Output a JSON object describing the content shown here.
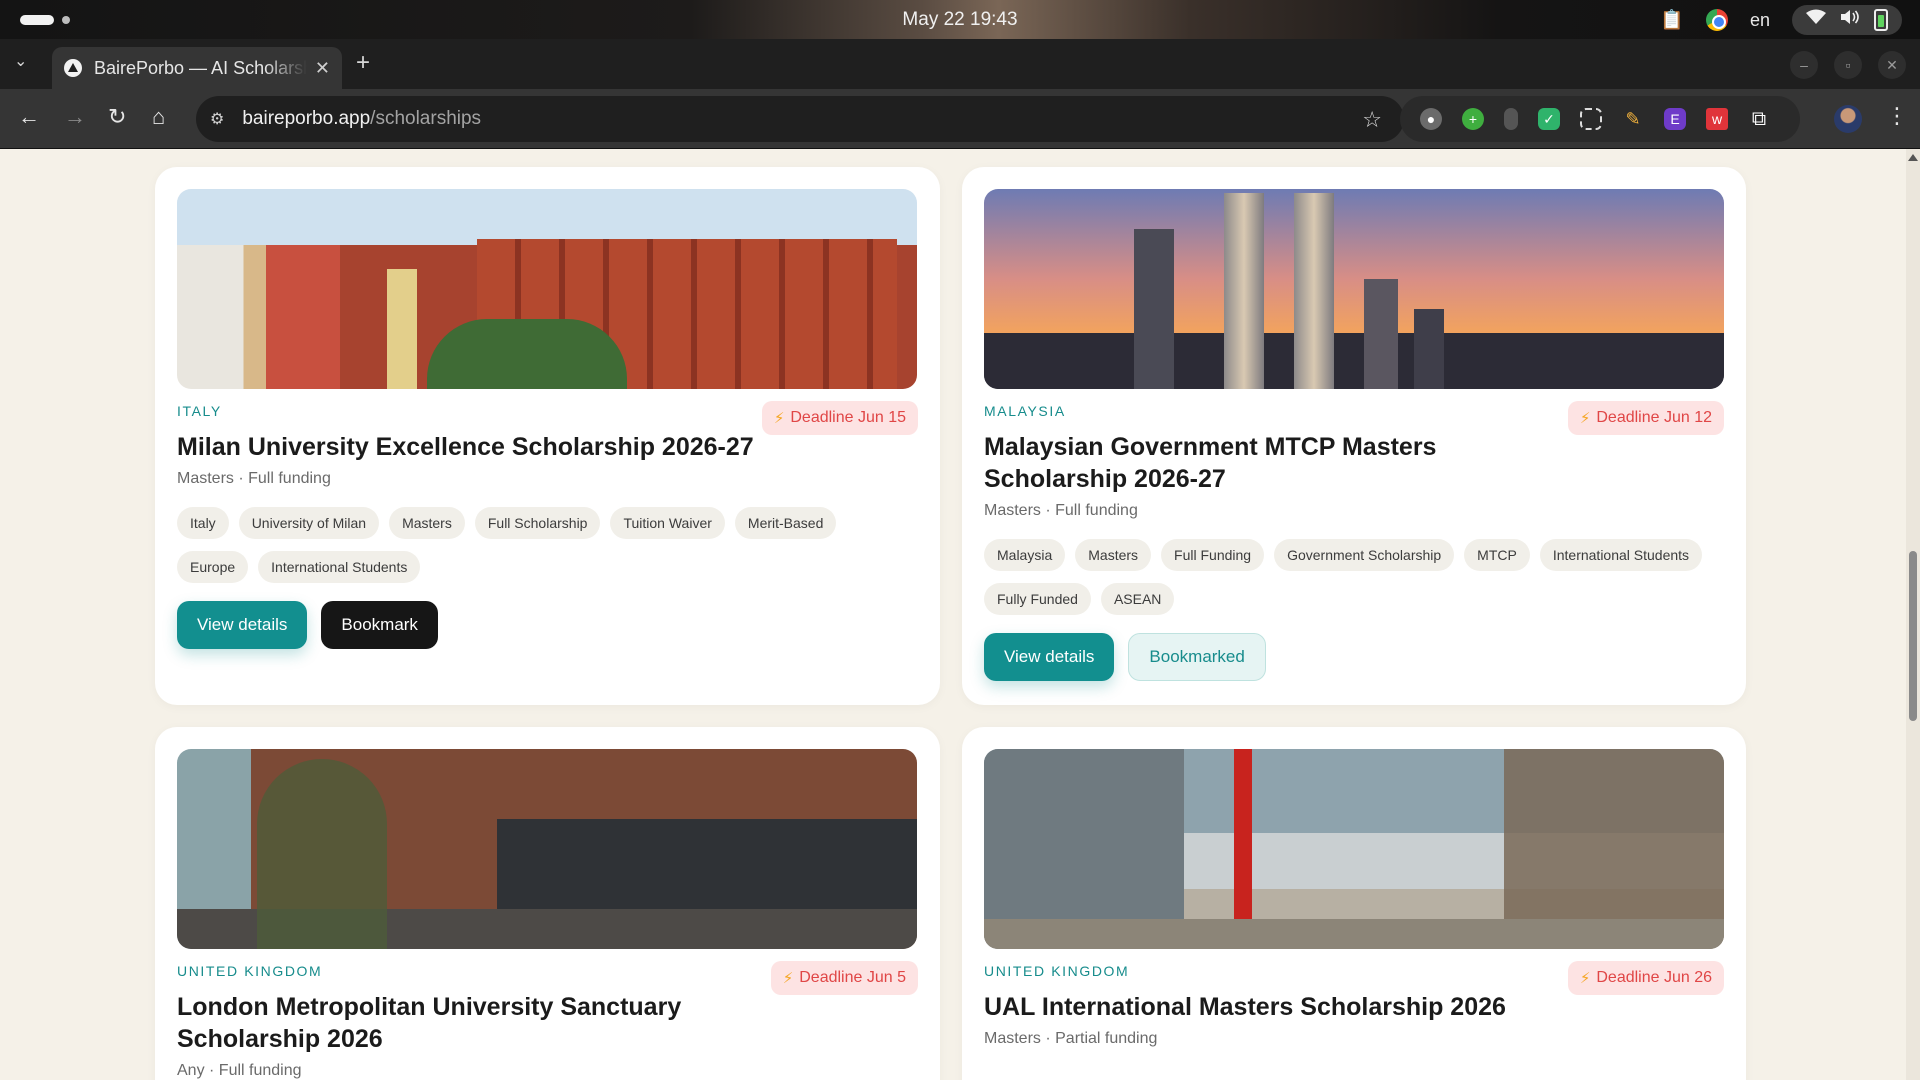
{
  "os": {
    "clock": "May 22  19:43",
    "language": "en"
  },
  "browser": {
    "tab_title": "BairePorbo — AI Scholarship",
    "url_host": "baireporbo.app",
    "url_path": "/scholarships"
  },
  "colors": {
    "accent": "#128f8f",
    "deadline_text": "#e04646",
    "deadline_bg": "#fde3e3",
    "page_bg": "#f5f1e8"
  },
  "cards": [
    {
      "country": "ITALY",
      "deadline": "Deadline Jun 15",
      "title": "Milan University Excellence Scholarship 2026-27",
      "meta": "Masters · Full funding",
      "tags": [
        "Italy",
        "University of Milan",
        "Masters",
        "Full Scholarship",
        "Tuition Waiver",
        "Merit-Based",
        "Europe",
        "International Students"
      ],
      "view_label": "View details",
      "bookmark_label": "Bookmark"
    },
    {
      "country": "MALAYSIA",
      "deadline": "Deadline Jun 12",
      "title": "Malaysian Government MTCP Masters Scholarship 2026-27",
      "meta": "Masters · Full funding",
      "tags": [
        "Malaysia",
        "Masters",
        "Full Funding",
        "Government Scholarship",
        "MTCP",
        "International Students",
        "Fully Funded",
        "ASEAN"
      ],
      "view_label": "View details",
      "bookmark_label": "Bookmarked"
    },
    {
      "country": "UNITED KINGDOM",
      "deadline": "Deadline Jun 5",
      "title": "London Metropolitan University Sanctuary Scholarship 2026",
      "meta": "Any · Full funding"
    },
    {
      "country": "UNITED KINGDOM",
      "deadline": "Deadline Jun 26",
      "title": "UAL International Masters Scholarship 2026",
      "meta": "Masters · Partial funding"
    }
  ]
}
